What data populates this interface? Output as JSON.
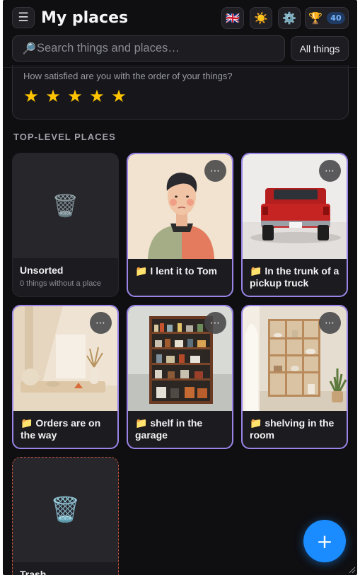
{
  "header": {
    "title": "My places",
    "menu_icon": "☰",
    "language_icon": "🇬🇧",
    "theme_icon": "☀️",
    "settings_icon": "⚙️",
    "trophy_icon": "🏆",
    "trophy_count": "40"
  },
  "search": {
    "icon": "🔎",
    "placeholder": "Search things and places…",
    "value": "",
    "filter_label": "All things"
  },
  "rating": {
    "question": "How satisfied are you with the order of your things?",
    "stars": [
      "★",
      "★",
      "★",
      "★",
      "★"
    ],
    "value": 5,
    "star_color": "#ffc400"
  },
  "section_title": "TOP-LEVEL PLACES",
  "places": [
    {
      "name": "Unsorted",
      "subtitle": "0 things without a place",
      "icon": "🗑️"
    },
    {
      "name": "📁 I lent it to Tom",
      "more": "⋯"
    },
    {
      "name": "📁 In the trunk of a pickup truck",
      "more": "⋯"
    },
    {
      "name": "📁 Orders are on the way",
      "more": "⋯"
    },
    {
      "name": "📁 shelf in the garage",
      "more": "⋯"
    },
    {
      "name": "📁 shelving in the room",
      "more": "⋯"
    },
    {
      "name": "Trash",
      "icon": "🗑️"
    }
  ],
  "fab_label": "+",
  "colors": {
    "background": "#0f0f12",
    "card_outline": "#9b85e8",
    "trash_outline": "#c2533f",
    "accent": "#1a8cff"
  }
}
